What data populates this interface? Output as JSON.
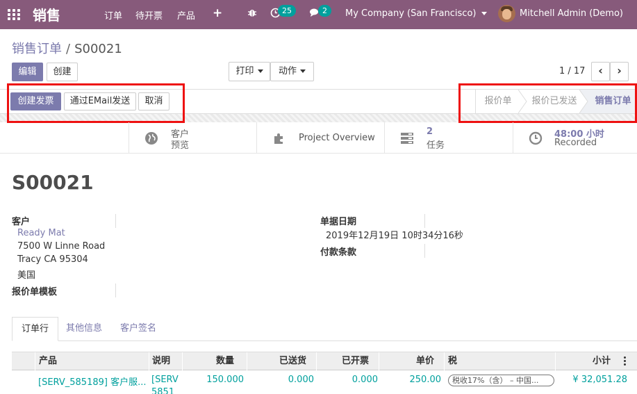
{
  "navbar": {
    "app_title": "销售",
    "menus": [
      "订单",
      "待开票",
      "产品"
    ],
    "activity_count": "25",
    "message_count": "2",
    "company": "My Company (San Francisco)",
    "user": "Mitchell Admin (Demo)"
  },
  "breadcrumb": {
    "parent": "销售订单",
    "separator": "/",
    "current": "S00021"
  },
  "toolbar": {
    "edit_label": "编辑",
    "create_label": "创建",
    "print_label": "打印",
    "action_label": "动作",
    "pager": "1 / 17"
  },
  "header_buttons": {
    "create_invoice": "创建发票",
    "send_email": "通过EMail发送",
    "cancel": "取消"
  },
  "statusbar": {
    "stages": [
      "报价单",
      "报价已发送",
      "销售订单"
    ],
    "active_stage": "销售订单"
  },
  "stat_buttons": {
    "preview_line1": "客户",
    "preview_line2": "预览",
    "project_overview": "Project Overview",
    "tasks_count": "2",
    "tasks_label": "任务",
    "hours_value": "48:00 小时",
    "hours_label": "Recorded"
  },
  "sheet": {
    "title": "S00021",
    "customer_label": "客户",
    "customer_name": "Ready Mat",
    "address_line1": "7500 W Linne Road",
    "address_line2": "Tracy CA 95304",
    "address_country": "美国",
    "quote_template_label": "报价单模板",
    "order_date_label": "单据日期",
    "order_date_value": "2019年12月19日 10时34分16秒",
    "payment_terms_label": "付款条款"
  },
  "tabs": [
    "订单行",
    "其他信息",
    "客户签名"
  ],
  "order_lines": {
    "columns": [
      "产品",
      "说明",
      "数量",
      "已送货",
      "已开票",
      "单价",
      "税",
      "小计"
    ],
    "rows": [
      {
        "product": "[SERV_585189] 客户服...",
        "description": "[SERV",
        "description_line2": "5851",
        "quantity": "150.000",
        "delivered": "0.000",
        "invoiced": "0.000",
        "unit_price": "250.00",
        "tax": "税收17%（含） – 中国...",
        "subtotal": "¥ 32,051.28"
      }
    ]
  },
  "colors": {
    "brand": "#875a7b",
    "accent": "#7c7bad",
    "link_teal": "#00a09d",
    "highlight_box": "#ee1111"
  }
}
